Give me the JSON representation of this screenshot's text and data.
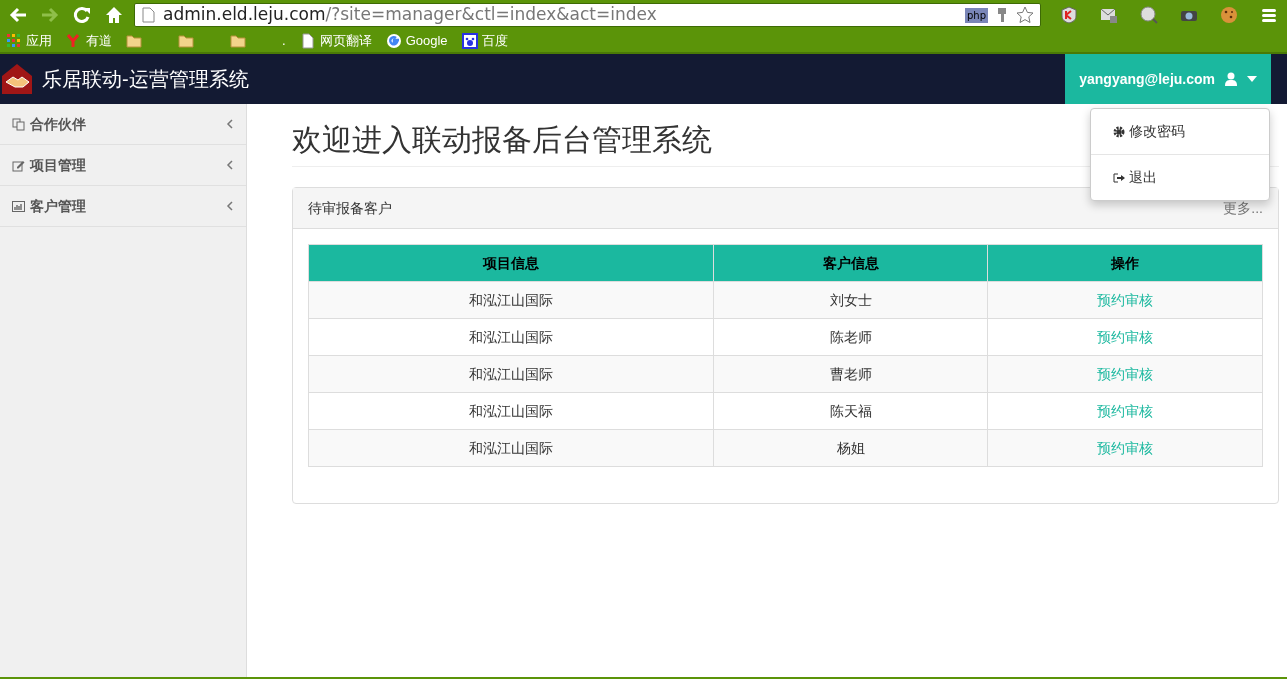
{
  "browser": {
    "url_host": "admin.eld.leju.com",
    "url_path": "/?site=manager&ctl=index&act=index",
    "php_badge": "php",
    "bookmarks": [
      {
        "kind": "apps",
        "label": "应用"
      },
      {
        "kind": "youdao",
        "label": "有道"
      },
      {
        "kind": "folder"
      },
      {
        "kind": "folder"
      },
      {
        "kind": "folder"
      },
      {
        "kind": "text",
        "label": "."
      },
      {
        "kind": "page",
        "label": "网页翻译"
      },
      {
        "kind": "google",
        "label": "Google"
      },
      {
        "kind": "baidu",
        "label": "百度"
      }
    ]
  },
  "app": {
    "title": "乐居联动-运营管理系统",
    "user": "yangyang@leju.com",
    "user_menu": {
      "expanded": true,
      "items": [
        {
          "kind": "gear",
          "label": "修改密码"
        },
        {
          "kind": "logout",
          "label": "退出"
        }
      ]
    },
    "sidebar": {
      "items": [
        {
          "kind": "copy",
          "label": "合作伙伴",
          "expanded": false
        },
        {
          "kind": "edit",
          "label": "项目管理",
          "expanded": false
        },
        {
          "kind": "chart",
          "label": "客户管理",
          "expanded": false
        }
      ]
    },
    "heading": "欢迎进入联动报备后台管理系统",
    "panel": {
      "title": "待审报备客户",
      "more": "更多...",
      "table": {
        "columns": [
          "项目信息",
          "客户信息",
          "操作"
        ],
        "rows": [
          {
            "project": "和泓江山国际",
            "customer": "刘女士",
            "action": "预约审核"
          },
          {
            "project": "和泓江山国际",
            "customer": "陈老师",
            "action": "预约审核"
          },
          {
            "project": "和泓江山国际",
            "customer": "曹老师",
            "action": "预约审核"
          },
          {
            "project": "和泓江山国际",
            "customer": "陈天福",
            "action": "预约审核"
          },
          {
            "project": "和泓江山国际",
            "customer": "杨姐",
            "action": "预约审核"
          }
        ]
      }
    }
  }
}
